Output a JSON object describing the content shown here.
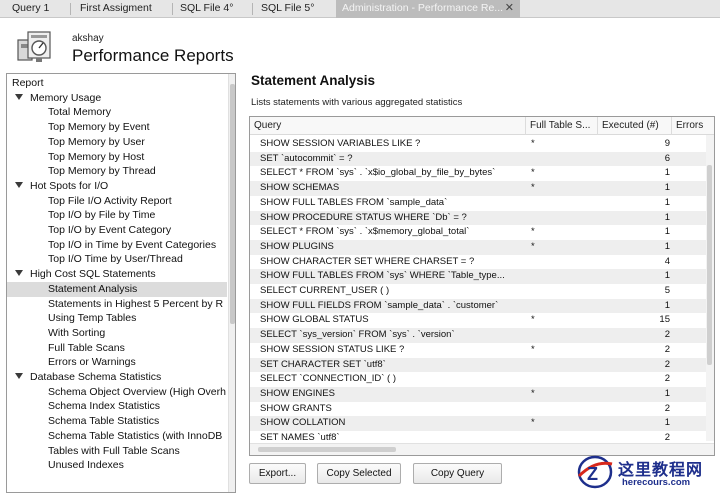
{
  "tabs": [
    {
      "label": "Query 1",
      "active": false
    },
    {
      "label": "First Assigment",
      "active": false
    },
    {
      "label": "SQL File 4°",
      "active": false
    },
    {
      "label": "SQL File 5°",
      "active": false
    },
    {
      "label": "Administration - Performance Re...",
      "active": true
    }
  ],
  "tab_close_glyph": "✕",
  "header": {
    "user": "akshay",
    "title": "Performance Reports",
    "icon": "performance-reports-icon"
  },
  "tree": {
    "root": "Report",
    "groups": [
      {
        "label": "Memory Usage",
        "items": [
          "Total Memory",
          "Top Memory by Event",
          "Top Memory by User",
          "Top Memory by Host",
          "Top Memory by Thread"
        ]
      },
      {
        "label": "Hot Spots for I/O",
        "items": [
          "Top File I/O Activity Report",
          "Top I/O by File by Time",
          "Top I/O by Event Category",
          "Top I/O in Time by Event Categories",
          "Top I/O Time by User/Thread"
        ]
      },
      {
        "label": "High Cost SQL Statements",
        "items": [
          "Statement Analysis",
          "Statements in Highest 5 Percent by R",
          "Using Temp Tables",
          "With Sorting",
          "Full Table Scans",
          "Errors or Warnings"
        ]
      },
      {
        "label": "Database Schema Statistics",
        "items": [
          "Schema Object Overview (High Overh",
          "Schema Index Statistics",
          "Schema Table Statistics",
          "Schema Table Statistics (with InnoDB",
          "Tables with Full Table Scans",
          "Unused Indexes"
        ]
      }
    ],
    "selected": "Statement Analysis"
  },
  "main": {
    "title": "Statement Analysis",
    "subtitle": "Lists statements with various aggregated statistics",
    "columns": [
      "Query",
      "Full Table S...",
      "Executed (#)",
      "Errors"
    ],
    "rows": [
      {
        "query": "SHOW SESSION VARIABLES LIKE ?",
        "full": "*",
        "executed": "9"
      },
      {
        "query": "SET `autocommit` = ?",
        "full": "",
        "executed": "6"
      },
      {
        "query": "SELECT * FROM `sys` . `x$io_global_by_file_by_bytes`",
        "full": "*",
        "executed": "1"
      },
      {
        "query": "SHOW SCHEMAS",
        "full": "*",
        "executed": "1"
      },
      {
        "query": "SHOW FULL TABLES FROM `sample_data`",
        "full": "",
        "executed": "1"
      },
      {
        "query": "SHOW PROCEDURE STATUS WHERE `Db` = ?",
        "full": "",
        "executed": "1"
      },
      {
        "query": "SELECT * FROM `sys` . `x$memory_global_total`",
        "full": "*",
        "executed": "1"
      },
      {
        "query": "SHOW PLUGINS",
        "full": "*",
        "executed": "1"
      },
      {
        "query": "SHOW CHARACTER SET WHERE CHARSET = ?",
        "full": "",
        "executed": "4"
      },
      {
        "query": "SHOW FULL TABLES FROM `sys` WHERE `Table_type...",
        "full": "",
        "executed": "1"
      },
      {
        "query": "SELECT CURRENT_USER ( )",
        "full": "",
        "executed": "5"
      },
      {
        "query": "SHOW FULL FIELDS FROM `sample_data` . `customer`",
        "full": "",
        "executed": "1"
      },
      {
        "query": "SHOW GLOBAL STATUS",
        "full": "*",
        "executed": "15"
      },
      {
        "query": "SELECT `sys_version` FROM `sys` . `version`",
        "full": "",
        "executed": "2"
      },
      {
        "query": "SHOW SESSION STATUS LIKE ?",
        "full": "*",
        "executed": "2"
      },
      {
        "query": "SET CHARACTER SET `utf8`",
        "full": "",
        "executed": "2"
      },
      {
        "query": "SELECT `CONNECTION_ID` ( )",
        "full": "",
        "executed": "2"
      },
      {
        "query": "SHOW ENGINES",
        "full": "*",
        "executed": "1"
      },
      {
        "query": "SHOW GRANTS",
        "full": "",
        "executed": "2"
      },
      {
        "query": "SHOW COLLATION",
        "full": "*",
        "executed": "1"
      },
      {
        "query": "SET NAMES `utf8`",
        "full": "",
        "executed": "2"
      }
    ],
    "buttons": {
      "export": "Export...",
      "copy_selected": "Copy Selected",
      "copy_query": "Copy Query"
    }
  },
  "watermark": {
    "text": "这里教程网",
    "url": "herecours.com",
    "letter": "Z"
  },
  "colors": {
    "accent_tab": "#bcbcbc",
    "selection": "#dcdcdc",
    "watermark_blue": "#1e2f8c",
    "watermark_red": "#d7281c"
  }
}
